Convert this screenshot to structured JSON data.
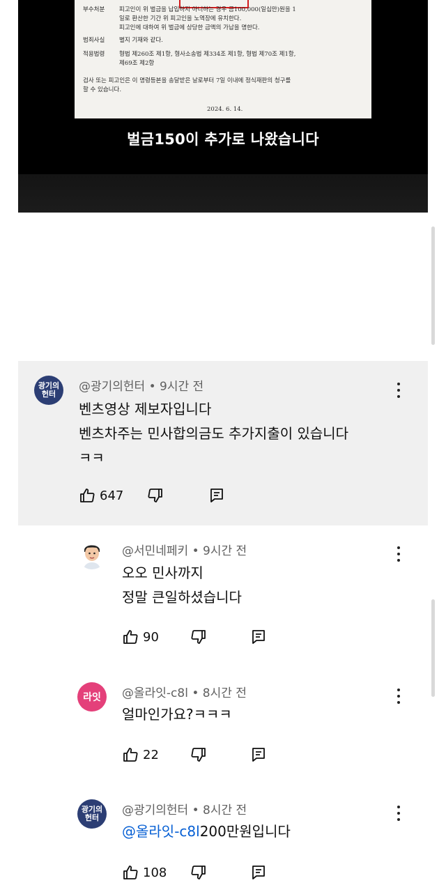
{
  "video": {
    "document_rows": [
      {
        "label": "부수처분",
        "text": "피고인이 위 벌금을 납입하지 아니하는 경우 금100,000(일십만)원을 1"
      },
      {
        "label": "",
        "text": "일로 환산한 기간 위 피고인을 노역장에 유치한다."
      },
      {
        "label": "",
        "text": "피고인에 대하여 위 벌금에 상당한 금액의 가납을 명한다."
      },
      {
        "label": "범죄사실",
        "text": "별지 기재와 같다."
      },
      {
        "label": "적용법령",
        "text": "형법 제260조 제1항, 형사소송법 제334조 제1항, 형법 제70조 제1항,"
      },
      {
        "label": "",
        "text": "제69조 제2항"
      },
      {
        "label": "",
        "text": "검사 또는 피고인은 이 명령등본을 송달받은 날로부터 7일 이내에 정식재판의 청구를"
      },
      {
        "label": "",
        "text": "할 수 있습니다."
      }
    ],
    "document_date": "2024. 6. 14.",
    "caption": "벌금150이 추가로 나왔습니다"
  },
  "comments": [
    {
      "avatar_text": "광기의\n헌터",
      "author": "@광기의헌터",
      "time": "9시간 전",
      "lines": [
        "벤츠영상 제보자입니다",
        "벤츠차주는 민사합의금도 추가지출이 있습니다",
        "ㅋㅋ"
      ],
      "likes": "647"
    },
    {
      "author": "@서민네페키",
      "time": "9시간 전",
      "lines": [
        "오오 민사까지",
        "정말 큰일하셨습니다"
      ],
      "likes": "90"
    },
    {
      "avatar_text": "라잇",
      "author": "@올라잇-c8l",
      "time": "8시간 전",
      "lines": [
        "얼마인가요?ㅋㅋㅋ"
      ],
      "likes": "22"
    },
    {
      "avatar_text": "광기의\n헌터",
      "author": "@광기의헌터",
      "time": "8시간 전",
      "mention": "@올라잇-c8l",
      "reply_text": "200만원입니다",
      "likes": "108"
    }
  ],
  "meta_separator": "•",
  "icons": [
    "thumb-up-icon",
    "thumb-down-icon",
    "reply-icon",
    "more-vert-icon"
  ],
  "colors": {
    "mention": "#065fd4",
    "thread_bg": "#f0f0f0",
    "line_avatar": "#e4407a",
    "hunter_avatar": "#2c3e74"
  }
}
